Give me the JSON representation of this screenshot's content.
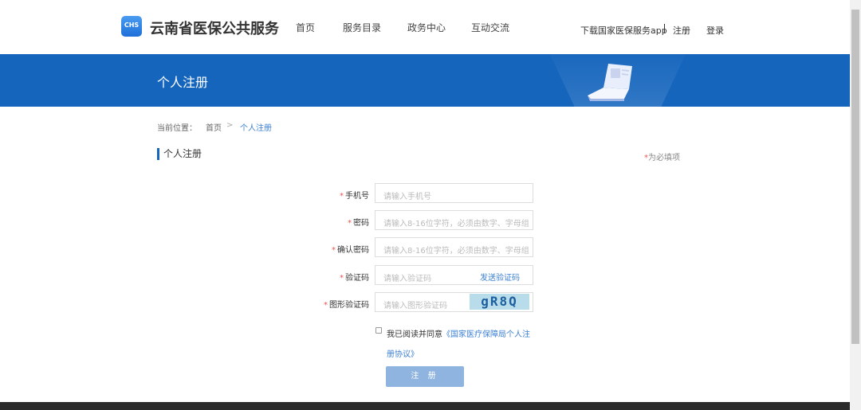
{
  "header": {
    "logo_text": "CHS",
    "site_title": "云南省医保公共服务",
    "nav": [
      "首页",
      "服务目录",
      "政务中心",
      "互动交流"
    ],
    "download_app": "下载国家医保服务app",
    "register": "注册",
    "login": "登录"
  },
  "banner": {
    "title": "个人注册"
  },
  "breadcrumb": {
    "prefix": "当前位置：",
    "home": "首页",
    "separator": ">",
    "current": "个人注册"
  },
  "section": {
    "title": "个人注册",
    "required_star": "*",
    "required_note": "为必填项"
  },
  "form": {
    "fields": [
      {
        "label": "手机号",
        "placeholder": "请输入手机号"
      },
      {
        "label": "密码",
        "placeholder": "请输入8-16位字符，必须由数字、字母组"
      },
      {
        "label": "确认密码",
        "placeholder": "请输入8-16位字符，必须由数字、字母组"
      },
      {
        "label": "验证码",
        "placeholder": "请输入验证码"
      },
      {
        "label": "图形验证码",
        "placeholder": "请输入图形验证码"
      }
    ],
    "star": "*",
    "send_code": "发送验证码",
    "captcha_text": "gR8Q",
    "agree_text": "我已阅读并同意",
    "agreement_link": "《国家医疗保障局个人注册协议》",
    "submit": "注 册"
  },
  "colors": {
    "primary": "#1565bd",
    "link": "#3b7fd1",
    "button": "#8fb4e0",
    "required": "#e55555"
  }
}
